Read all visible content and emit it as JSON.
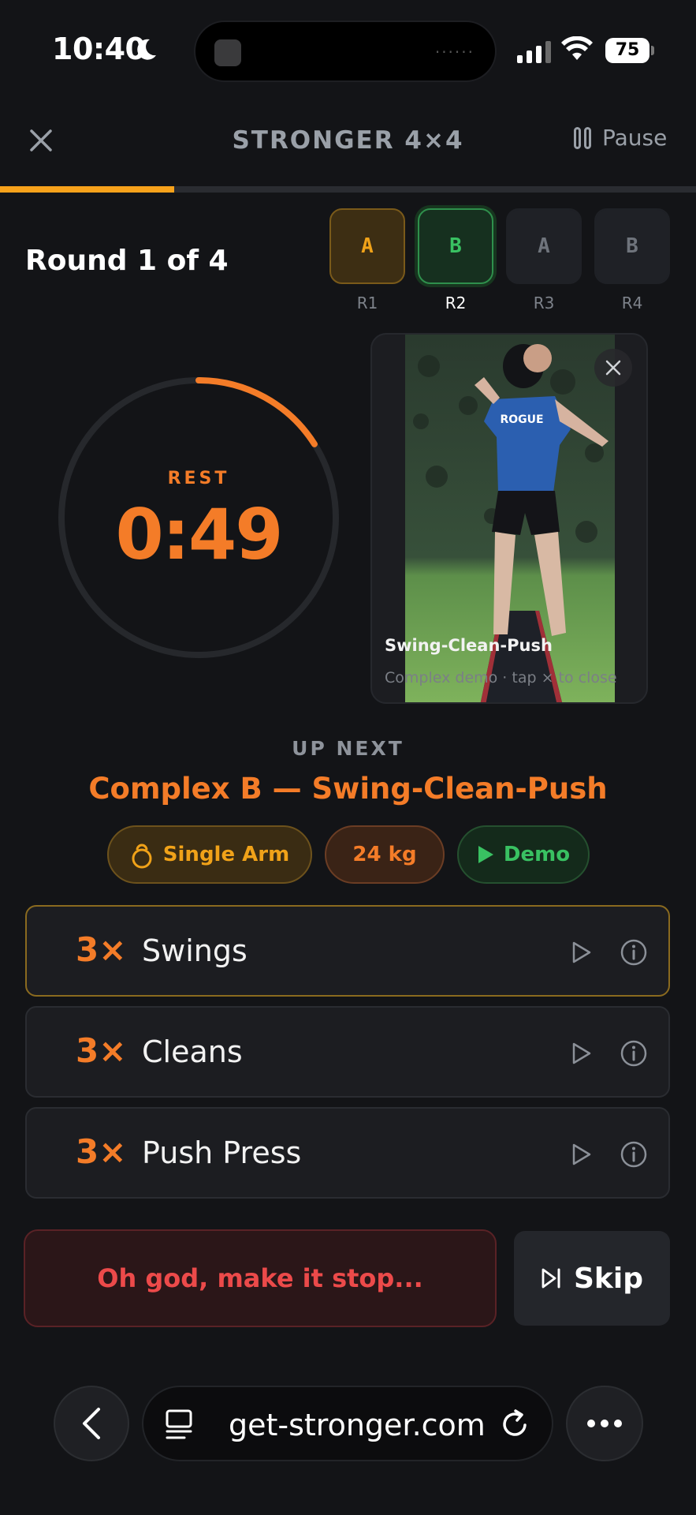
{
  "status": {
    "time": "10:40",
    "battery": "75"
  },
  "header": {
    "title": "STRONGER 4×4",
    "pause_label": "Pause",
    "progress_fraction": 0.25
  },
  "round": {
    "label": "Round 1 of 4",
    "chips": [
      {
        "letter": "A",
        "label": "R1",
        "state": "done"
      },
      {
        "letter": "B",
        "label": "R2",
        "state": "current"
      },
      {
        "letter": "A",
        "label": "R3",
        "state": "upcoming"
      },
      {
        "letter": "B",
        "label": "R4",
        "state": "upcoming"
      }
    ]
  },
  "timer": {
    "label": "REST",
    "value": "0:49",
    "progress_fraction": 0.16
  },
  "demo": {
    "title": "Swing-Clean-Push",
    "subtitle": "Complex demo · tap × to close"
  },
  "up_next": {
    "label": "UP NEXT",
    "title": "Complex B — Swing-Clean-Push",
    "pills": {
      "arm": "Single Arm",
      "weight": "24 kg",
      "demo": "Demo"
    }
  },
  "exercises": [
    {
      "reps": "3×",
      "name": "Swings",
      "active": true
    },
    {
      "reps": "3×",
      "name": "Cleans",
      "active": false
    },
    {
      "reps": "3×",
      "name": "Push Press",
      "active": false
    }
  ],
  "actions": {
    "stop_label": "Oh god, make it stop...",
    "skip_label": "Skip"
  },
  "browser": {
    "url": "get-stronger.com"
  },
  "colors": {
    "accent": "#f47c28",
    "amber": "#f0a219",
    "green": "#39c162",
    "danger": "#ec4a4a"
  }
}
